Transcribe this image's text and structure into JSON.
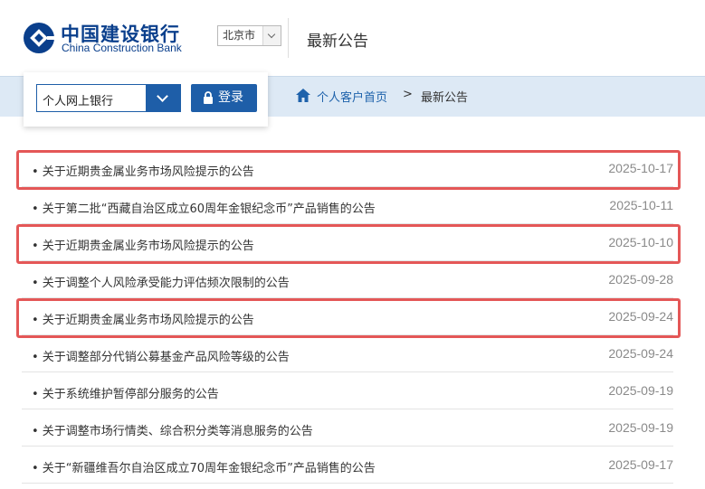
{
  "header": {
    "logo_cn": "中国建设银行",
    "logo_en": "China Construction Bank",
    "city": "北京市",
    "title": "最新公告"
  },
  "login": {
    "channel": "个人网上银行",
    "login_label": "登录"
  },
  "breadcrumb": {
    "home": "个人客户首页",
    "separator": ">",
    "current": "最新公告"
  },
  "announcements": [
    {
      "title": "• 关于近期贵金属业务市场风险提示的公告",
      "date": "2025-10-17",
      "highlighted": true
    },
    {
      "title": "• 关于第二批“西藏自治区成立60周年金银纪念币”产品销售的公告",
      "date": "2025-10-11",
      "highlighted": false
    },
    {
      "title": "• 关于近期贵金属业务市场风险提示的公告",
      "date": "2025-10-10",
      "highlighted": true
    },
    {
      "title": "• 关于调整个人风险承受能力评估频次限制的公告",
      "date": "2025-09-28",
      "highlighted": false
    },
    {
      "title": "• 关于近期贵金属业务市场风险提示的公告",
      "date": "2025-09-24",
      "highlighted": true
    },
    {
      "title": "• 关于调整部分代销公募基金产品风险等级的公告",
      "date": "2025-09-24",
      "highlighted": false
    },
    {
      "title": "• 关于系统维护暂停部分服务的公告",
      "date": "2025-09-19",
      "highlighted": false
    },
    {
      "title": "• 关于调整市场行情类、综合积分类等消息服务的公告",
      "date": "2025-09-19",
      "highlighted": false
    },
    {
      "title": "• 关于“新疆维吾尔自治区成立70周年金银纪念币”产品销售的公告",
      "date": "2025-09-17",
      "highlighted": false
    }
  ],
  "colors": {
    "brand_blue": "#1e5ea8",
    "band_bg": "#dde9f5",
    "highlight_red": "#e45757",
    "link_blue": "#1e62ab"
  }
}
